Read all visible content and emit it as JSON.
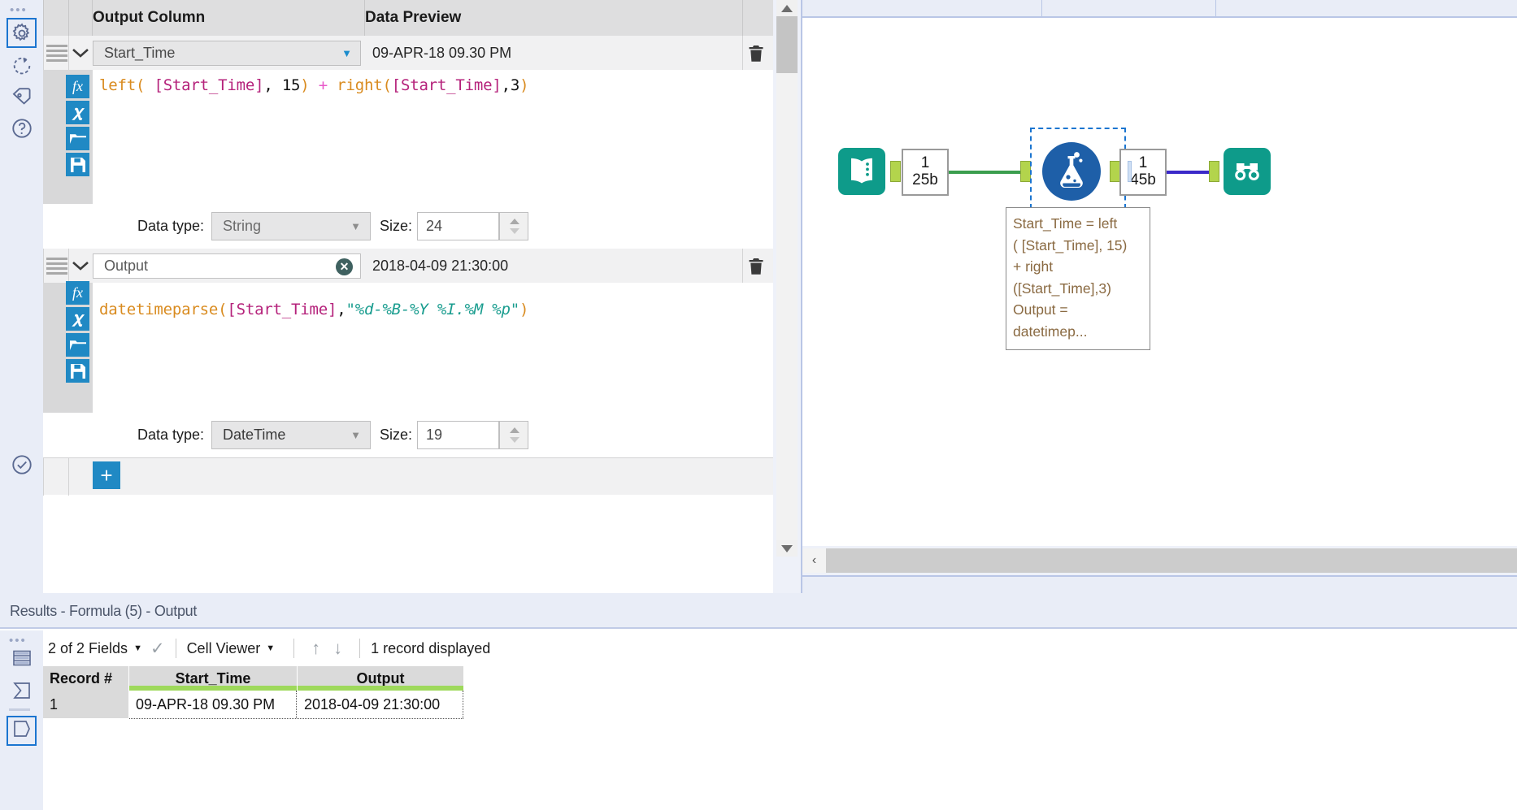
{
  "sidebar": {
    "grip": "•••",
    "items": [
      {
        "name": "configuration",
        "label": "Configuration",
        "icon": "gear-icon",
        "selected": true
      },
      {
        "name": "annotation",
        "label": "Annotation",
        "icon": "refresh-circle-icon",
        "selected": false
      },
      {
        "name": "labels",
        "label": "Labels",
        "icon": "tag-icon",
        "selected": false
      },
      {
        "name": "help",
        "label": "Help",
        "icon": "question-circle-icon",
        "selected": false
      }
    ],
    "bottom_item": {
      "name": "validate",
      "label": "Validate",
      "icon": "check-circle-icon"
    }
  },
  "config_panel": {
    "headers": {
      "output_column": "Output Column",
      "data_preview": "Data Preview"
    },
    "add_button_label": "+",
    "rows": [
      {
        "field_name": "Start_Time",
        "field_editable": false,
        "data_preview": "09-APR-18 09.30 PM",
        "formula_tokens": [
          {
            "t": "left(",
            "c": "fn"
          },
          {
            "t": " ",
            "c": "pl"
          },
          {
            "t": "[Start_Time]",
            "c": "fld"
          },
          {
            "t": ", ",
            "c": "pl"
          },
          {
            "t": "15",
            "c": "num"
          },
          {
            "t": ")",
            "c": "fn"
          },
          {
            "t": " ",
            "c": "pl"
          },
          {
            "t": "+",
            "c": "op"
          },
          {
            "t": " ",
            "c": "pl"
          },
          {
            "t": "right(",
            "c": "fn"
          },
          {
            "t": "[Start_Time]",
            "c": "fld"
          },
          {
            "t": ",",
            "c": "pl"
          },
          {
            "t": "3",
            "c": "num"
          },
          {
            "t": ")",
            "c": "fn"
          }
        ],
        "formula_plain": "left( [Start_Time], 15) + right([Start_Time],3)",
        "data_type_label": "Data type:",
        "data_type_value": "String",
        "size_label": "Size:",
        "size_value": "24"
      },
      {
        "field_name": "Output",
        "field_editable": true,
        "data_preview": "2018-04-09 21:30:00",
        "formula_tokens": [
          {
            "t": "datetimeparse(",
            "c": "fn"
          },
          {
            "t": "[Start_Time]",
            "c": "fld"
          },
          {
            "t": ",",
            "c": "pl"
          },
          {
            "t": "\"%d-%B-%Y %I.%M %p\"",
            "c": "str"
          },
          {
            "t": ")",
            "c": "fn"
          }
        ],
        "formula_plain": "datetimeparse([Start_Time],\"%d-%B-%Y %I.%M %p\")",
        "data_type_label": "Data type:",
        "data_type_value": "DateTime",
        "size_label": "Size:",
        "size_value": "19"
      }
    ],
    "editor_buttons": [
      {
        "name": "insert-function-button",
        "glyph": "fx"
      },
      {
        "name": "insert-variable-button",
        "glyph": "X"
      },
      {
        "name": "open-formula-button",
        "glyph": "folder"
      },
      {
        "name": "save-formula-button",
        "glyph": "save"
      }
    ],
    "delete_icon": "trash-icon"
  },
  "canvas": {
    "nodes": [
      {
        "name": "text-input-tool",
        "icon": "book-icon",
        "color": "#0e9b8a"
      },
      {
        "name": "formula-tool",
        "icon": "flask-icon",
        "color": "#1e5fa8",
        "selected": true
      },
      {
        "name": "browse-tool",
        "icon": "binoculars-icon",
        "color": "#0e9b8a"
      }
    ],
    "connections": [
      {
        "name": "connection-1",
        "count": "1",
        "size": "25b"
      },
      {
        "name": "connection-2",
        "count": "1",
        "size": "45b"
      }
    ],
    "annotation_lines": [
      "Start_Time = left",
      "( [Start_Time], 15)",
      "+ right",
      "([Start_Time],3)",
      "Output =",
      "datetimep..."
    ],
    "scroll_left_arrow": "‹"
  },
  "results": {
    "title": "Results - Formula (5) - Output",
    "toolbar": {
      "fields_label": "2 of 2 Fields",
      "viewer_label": "Cell Viewer",
      "record_count_label": "1 record displayed",
      "check_icon": "check-icon",
      "up_icon": "arrow-up-icon",
      "down_icon": "arrow-down-icon"
    },
    "rail_items": [
      {
        "name": "results-table-view",
        "icon": "table-icon",
        "selected": false
      },
      {
        "name": "results-profile-view",
        "icon": "sigma-icon",
        "selected": false
      },
      {
        "name": "results-metadata-view",
        "icon": "data-page-icon",
        "selected": true
      }
    ],
    "table": {
      "columns": [
        "Record #",
        "Start_Time",
        "Output"
      ],
      "rows": [
        [
          "1",
          "09-APR-18 09.30 PM",
          "2018-04-09 21:30:00"
        ]
      ]
    }
  },
  "colors": {
    "accent_blue": "#1b75d0",
    "button_blue": "#2089c4",
    "teal_tool": "#0e9b8a",
    "formula_tool": "#1e5fa8",
    "header_green": "#9ed95b",
    "panel_bg": "#e9edf7"
  }
}
